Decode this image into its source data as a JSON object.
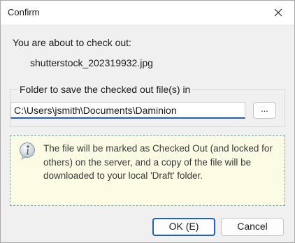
{
  "window": {
    "title": "Confirm"
  },
  "message": {
    "prompt": "You are about to check out:",
    "filename": "shutterstock_202319932.jpg"
  },
  "folder_group": {
    "label": "Folder to save the checked out file(s) in",
    "path_value": "C:\\Users\\jsmith\\Documents\\Daminion",
    "browse_label": "..."
  },
  "info": {
    "icon": "info-icon",
    "text": "The file will be marked as Checked Out (and locked for others) on the server, and a copy of the file will be downloaded to your local 'Draft' folder."
  },
  "buttons": {
    "ok_label": "OK (E)",
    "cancel_label": "Cancel"
  },
  "colors": {
    "accent": "#1f5fbf",
    "info_background": "#fcfce4",
    "dialog_background": "#f0f0f0"
  }
}
